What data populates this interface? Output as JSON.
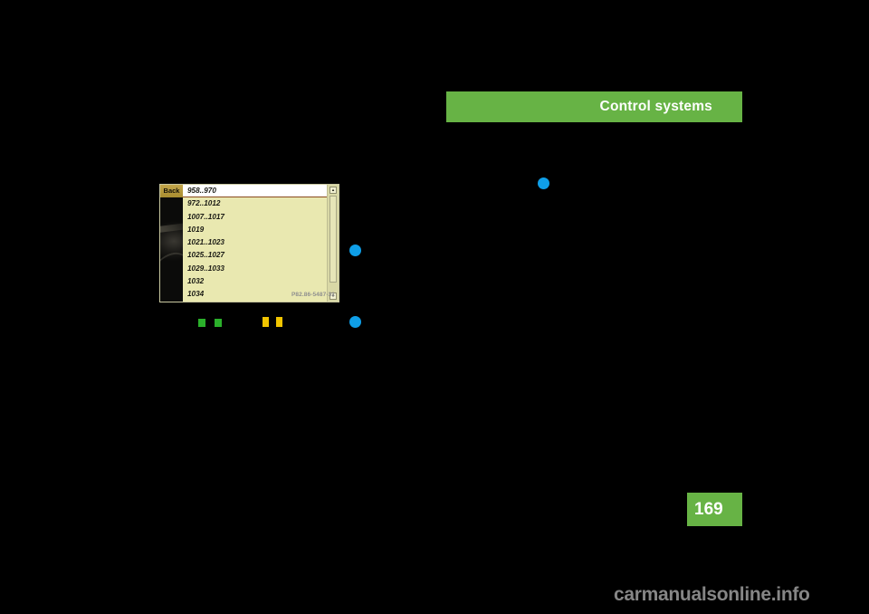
{
  "page": {
    "background_color": "#000000",
    "number": "169",
    "number_block_color": "#67b345"
  },
  "header": {
    "title": "Control systems",
    "accent_color": "#67b345",
    "text_color": "#ffffff"
  },
  "watermark": {
    "text": "carmanualsonline.info",
    "color": "#868686"
  },
  "figure": {
    "caption": "P82.86-5487-31",
    "screen": {
      "back_button_label": "Back",
      "back_button_color": "#b59a3c",
      "list_background_color": "#e9e8b0",
      "selected_row_color": "#ffffff",
      "selected_underline_color": "#8a4a1e",
      "rows": [
        {
          "label": "958..970",
          "selected": true
        },
        {
          "label": "972..1012",
          "selected": false
        },
        {
          "label": "1007..1017",
          "selected": false
        },
        {
          "label": "1019",
          "selected": false
        },
        {
          "label": "1021..1023",
          "selected": false
        },
        {
          "label": "1025..1027",
          "selected": false
        },
        {
          "label": "1029..1033",
          "selected": false
        },
        {
          "label": "1032",
          "selected": false
        },
        {
          "label": "1034",
          "selected": false
        }
      ],
      "scrollbar": {
        "arrow_up": "▴",
        "arrow_down": "▾"
      }
    }
  },
  "markers": {
    "blue_dot_color": "#0f9fe8",
    "green_glyph_color": "#2bb02b",
    "yellow_glyph_color": "#f2c500",
    "blue_dots": [
      {
        "name": "callout-dot-figure-upper"
      },
      {
        "name": "callout-dot-figure-lower"
      },
      {
        "name": "callout-dot-right-column"
      }
    ]
  }
}
